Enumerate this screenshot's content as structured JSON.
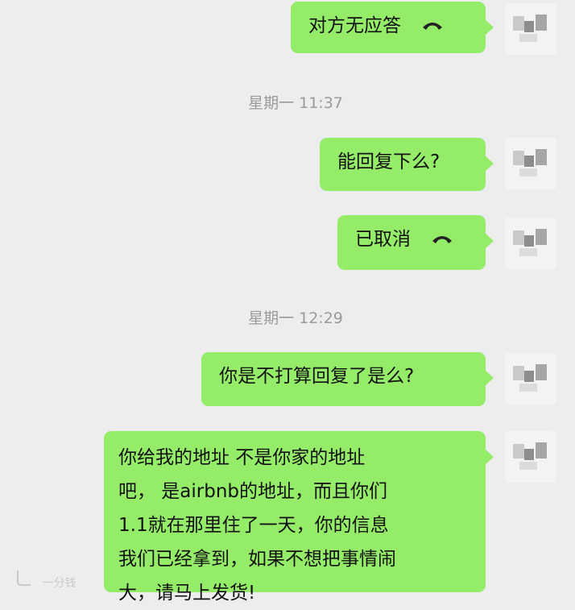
{
  "messages": [
    {
      "type": "call",
      "text": "对方无应答",
      "icon": "phone-hangup-icon"
    },
    {
      "type": "time",
      "text": "星期一 11:37"
    },
    {
      "type": "text",
      "text": "能回复下么?"
    },
    {
      "type": "call",
      "text": "已取消",
      "icon": "phone-hangup-icon"
    },
    {
      "type": "time",
      "text": "星期一 12:29"
    },
    {
      "type": "text",
      "text": "你是不打算回复了是么?"
    },
    {
      "type": "text",
      "lines": [
        "你给我的地址  不是你家的地址",
        "吧，  是airbnb的地址，而且你们",
        "1.1就在那里住了一天，你的信息",
        "我们已经拿到，如果不想把事情闹",
        "大，请马上发货!"
      ]
    }
  ],
  "colors": {
    "background": "#ededed",
    "bubble": "#95ec69",
    "timestamp": "#9a9a9a"
  },
  "watermark": "一分钱"
}
